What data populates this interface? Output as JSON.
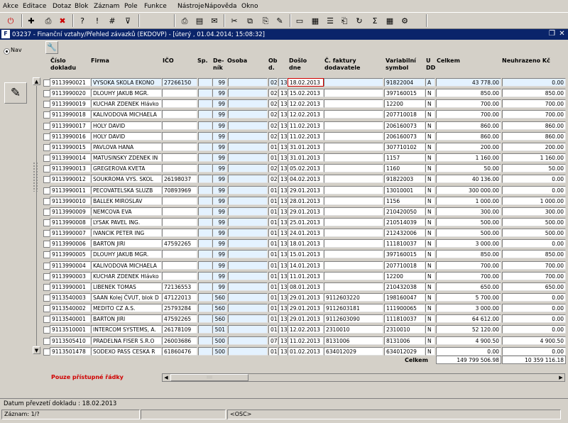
{
  "menu": [
    "Akce",
    "Editace",
    "Dotaz",
    "Blok",
    "Záznam",
    "Pole",
    "Funkce",
    "Nástroje",
    "Nápověda",
    "Okno"
  ],
  "toolbar_icons": [
    {
      "name": "exit-icon",
      "glyph": "⏻",
      "color": "#cc0000"
    },
    {
      "name": "save-icon",
      "glyph": "✚"
    },
    {
      "name": "print-preview-icon",
      "glyph": "⎙"
    },
    {
      "name": "delete-record-icon",
      "glyph": "✖",
      "color": "#cc0000"
    },
    {
      "name": "query-enter-icon",
      "glyph": "?"
    },
    {
      "name": "query-execute-icon",
      "glyph": "!"
    },
    {
      "name": "query-count-icon",
      "glyph": "#"
    },
    {
      "name": "filter-icon",
      "glyph": "⊽"
    },
    {
      "name": "print-icon",
      "glyph": "⎙"
    },
    {
      "name": "report-icon",
      "glyph": "▤"
    },
    {
      "name": "mail-icon",
      "glyph": "✉"
    },
    {
      "name": "cut-icon",
      "glyph": "✂"
    },
    {
      "name": "copy-icon",
      "glyph": "⧉"
    },
    {
      "name": "paste-icon",
      "glyph": "⎘"
    },
    {
      "name": "edit-icon",
      "glyph": "✎"
    },
    {
      "name": "document-icon",
      "glyph": "▭"
    },
    {
      "name": "calculator-icon",
      "glyph": "▦"
    },
    {
      "name": "list-icon",
      "glyph": "☰"
    },
    {
      "name": "attachment-icon",
      "glyph": "⎗"
    },
    {
      "name": "reload-icon",
      "glyph": "↻"
    },
    {
      "name": "sum-icon",
      "glyph": "Σ"
    },
    {
      "name": "grid-icon",
      "glyph": "▦"
    },
    {
      "name": "settings-icon",
      "glyph": "⚙"
    }
  ],
  "window": {
    "title": "03237 - Finanční vztahy/Přehled závazků (EKDOVP) - [úterý , 01.04.2014; 15:08:32]",
    "logo": "F"
  },
  "nav_label": "Nav",
  "columns": {
    "cislo": "Číslo dokladu",
    "firma": "Firma",
    "ico": "IČO",
    "sp": "Sp.",
    "denik": "De-ník",
    "osoba": "Osoba",
    "ob": "Ob d.",
    "doslo": "Došlo dne",
    "cfaktury": "Č. faktury dodavatele",
    "vs": "Variabilní symbol",
    "udd": "U DD",
    "celkem": "Celkem",
    "neuhrazeno": "Neuhrazeno Kč"
  },
  "rows": [
    {
      "cislo": "9113990021",
      "firma": "VYSOKA SKOLA EKONO",
      "ico": "27266150",
      "sp": "",
      "denik": "99",
      "osoba": "",
      "ob": "02",
      "o2": "13",
      "doslo": "18.02.2013",
      "cf": "",
      "vs": "91822004",
      "u": "A",
      "celkem": "43 778.00",
      "neuh": "0.00"
    },
    {
      "cislo": "9113990020",
      "firma": "DLOUHY JAKUB MGR.",
      "ico": "",
      "sp": "",
      "denik": "99",
      "osoba": "",
      "ob": "02",
      "o2": "13",
      "doslo": "15.02.2013",
      "cf": "",
      "vs": "397160015",
      "u": "N",
      "celkem": "850.00",
      "neuh": "850.00"
    },
    {
      "cislo": "9113990019",
      "firma": "KUCHAR ZDENEK Hlávko",
      "ico": "",
      "sp": "",
      "denik": "99",
      "osoba": "",
      "ob": "02",
      "o2": "13",
      "doslo": "12.02.2013",
      "cf": "",
      "vs": "12200",
      "u": "N",
      "celkem": "700.00",
      "neuh": "700.00"
    },
    {
      "cislo": "9113990018",
      "firma": "KALIVODOVA MICHAELA",
      "ico": "",
      "sp": "",
      "denik": "99",
      "osoba": "",
      "ob": "02",
      "o2": "13",
      "doslo": "12.02.2013",
      "cf": "",
      "vs": "207710018",
      "u": "N",
      "celkem": "700.00",
      "neuh": "700.00"
    },
    {
      "cislo": "9113990017",
      "firma": "HOLY DAVID",
      "ico": "",
      "sp": "",
      "denik": "99",
      "osoba": "",
      "ob": "02",
      "o2": "13",
      "doslo": "11.02.2013",
      "cf": "",
      "vs": "206160073",
      "u": "N",
      "celkem": "860.00",
      "neuh": "860.00"
    },
    {
      "cislo": "9113990016",
      "firma": "HOLY DAVID",
      "ico": "",
      "sp": "",
      "denik": "99",
      "osoba": "",
      "ob": "02",
      "o2": "13",
      "doslo": "11.02.2013",
      "cf": "",
      "vs": "206160073",
      "u": "N",
      "celkem": "860.00",
      "neuh": "860.00"
    },
    {
      "cislo": "9113990015",
      "firma": "PAVLOVA HANA",
      "ico": "",
      "sp": "",
      "denik": "99",
      "osoba": "",
      "ob": "01",
      "o2": "13",
      "doslo": "31.01.2013",
      "cf": "",
      "vs": "307710102",
      "u": "N",
      "celkem": "200.00",
      "neuh": "200.00"
    },
    {
      "cislo": "9113990014",
      "firma": "MATUSINSKY ZDENEK IN",
      "ico": "",
      "sp": "",
      "denik": "99",
      "osoba": "",
      "ob": "01",
      "o2": "13",
      "doslo": "31.01.2013",
      "cf": "",
      "vs": "1157",
      "u": "N",
      "celkem": "1 160.00",
      "neuh": "1 160.00"
    },
    {
      "cislo": "9113990013",
      "firma": "GREGEROVA KVETA",
      "ico": "",
      "sp": "",
      "denik": "99",
      "osoba": "",
      "ob": "02",
      "o2": "13",
      "doslo": "05.02.2013",
      "cf": "",
      "vs": "1160",
      "u": "N",
      "celkem": "50.00",
      "neuh": "50.00"
    },
    {
      "cislo": "9113990012",
      "firma": "SOUKROMA VYS. SKOL",
      "ico": "26198037",
      "sp": "",
      "denik": "99",
      "osoba": "",
      "ob": "02",
      "o2": "13",
      "doslo": "04.02.2013",
      "cf": "",
      "vs": "91822003",
      "u": "N",
      "celkem": "40 136.00",
      "neuh": "0.00"
    },
    {
      "cislo": "9113990011",
      "firma": "PECOVATELSKA SLUZB",
      "ico": "70893969",
      "sp": "",
      "denik": "99",
      "osoba": "",
      "ob": "01",
      "o2": "13",
      "doslo": "29.01.2013",
      "cf": "",
      "vs": "13010001",
      "u": "N",
      "celkem": "300 000.00",
      "neuh": "0.00"
    },
    {
      "cislo": "9113990010",
      "firma": "BALLEK MIROSLAV",
      "ico": "",
      "sp": "",
      "denik": "99",
      "osoba": "",
      "ob": "01",
      "o2": "13",
      "doslo": "28.01.2013",
      "cf": "",
      "vs": "1156",
      "u": "N",
      "celkem": "1 000.00",
      "neuh": "1 000.00"
    },
    {
      "cislo": "9113990009",
      "firma": "NEMCOVA EVA",
      "ico": "",
      "sp": "",
      "denik": "99",
      "osoba": "",
      "ob": "01",
      "o2": "13",
      "doslo": "29.01.2013",
      "cf": "",
      "vs": "210420050",
      "u": "N",
      "celkem": "300.00",
      "neuh": "300.00"
    },
    {
      "cislo": "9113990008",
      "firma": "LYSAK PAVEL ING.",
      "ico": "",
      "sp": "",
      "denik": "99",
      "osoba": "",
      "ob": "01",
      "o2": "13",
      "doslo": "25.01.2013",
      "cf": "",
      "vs": "210514039",
      "u": "N",
      "celkem": "500.00",
      "neuh": "500.00"
    },
    {
      "cislo": "9113990007",
      "firma": "IVANCIK PETER ING",
      "ico": "",
      "sp": "",
      "denik": "99",
      "osoba": "",
      "ob": "01",
      "o2": "13",
      "doslo": "24.01.2013",
      "cf": "",
      "vs": "212432006",
      "u": "N",
      "celkem": "500.00",
      "neuh": "500.00"
    },
    {
      "cislo": "9113990006",
      "firma": "BARTON JIRI",
      "ico": "47592265",
      "sp": "",
      "denik": "99",
      "osoba": "",
      "ob": "01",
      "o2": "13",
      "doslo": "18.01.2013",
      "cf": "",
      "vs": "111810037",
      "u": "N",
      "celkem": "3 000.00",
      "neuh": "0.00"
    },
    {
      "cislo": "9113990005",
      "firma": "DLOUHY JAKUB MGR.",
      "ico": "",
      "sp": "",
      "denik": "99",
      "osoba": "",
      "ob": "01",
      "o2": "13",
      "doslo": "15.01.2013",
      "cf": "",
      "vs": "397160015",
      "u": "N",
      "celkem": "850.00",
      "neuh": "850.00"
    },
    {
      "cislo": "9113990004",
      "firma": "KALIVODOVA MICHAELA",
      "ico": "",
      "sp": "",
      "denik": "99",
      "osoba": "",
      "ob": "01",
      "o2": "13",
      "doslo": "14.01.2013",
      "cf": "",
      "vs": "207710018",
      "u": "N",
      "celkem": "700.00",
      "neuh": "700.00"
    },
    {
      "cislo": "9113990003",
      "firma": "KUCHAR ZDENEK Hlávko",
      "ico": "",
      "sp": "",
      "denik": "99",
      "osoba": "",
      "ob": "01",
      "o2": "13",
      "doslo": "11.01.2013",
      "cf": "",
      "vs": "12200",
      "u": "N",
      "celkem": "700.00",
      "neuh": "700.00"
    },
    {
      "cislo": "9113990001",
      "firma": "LIBENEK TOMAS",
      "ico": "72136553",
      "sp": "",
      "denik": "99",
      "osoba": "",
      "ob": "01",
      "o2": "13",
      "doslo": "08.01.2013",
      "cf": "",
      "vs": "210432038",
      "u": "N",
      "celkem": "650.00",
      "neuh": "650.00"
    },
    {
      "cislo": "9113540003",
      "firma": "SAAN Kolej ČVUT, blok D",
      "ico": "47122013",
      "sp": "",
      "denik": "560",
      "osoba": "",
      "ob": "01",
      "o2": "13",
      "doslo": "29.01.2013",
      "cf": "9112603220",
      "vs": "198160047",
      "u": "N",
      "celkem": "5 700.00",
      "neuh": "0.00"
    },
    {
      "cislo": "9113540002",
      "firma": "MEDITO CZ A.S.",
      "ico": "25793284",
      "sp": "",
      "denik": "560",
      "osoba": "",
      "ob": "01",
      "o2": "13",
      "doslo": "29.01.2013",
      "cf": "9112603181",
      "vs": "111900065",
      "u": "N",
      "celkem": "3 000.00",
      "neuh": "0.00"
    },
    {
      "cislo": "9113540001",
      "firma": "BARTON JIRI",
      "ico": "47592265",
      "sp": "",
      "denik": "560",
      "osoba": "",
      "ob": "01",
      "o2": "13",
      "doslo": "29.01.2013",
      "cf": "9112603090",
      "vs": "111810037",
      "u": "N",
      "celkem": "64 612.00",
      "neuh": "0.00"
    },
    {
      "cislo": "9113510001",
      "firma": "INTERCOM SYSTEMS, A.",
      "ico": "26178109",
      "sp": "",
      "denik": "501",
      "osoba": "",
      "ob": "01",
      "o2": "13",
      "doslo": "12.02.2013",
      "cf": "2310010",
      "vs": "2310010",
      "u": "N",
      "celkem": "52 120.00",
      "neuh": "0.00"
    },
    {
      "cislo": "9113505410",
      "firma": "PRADELNA FISER S.R.O",
      "ico": "26003686",
      "sp": "",
      "denik": "500",
      "osoba": "",
      "ob": "07",
      "o2": "13",
      "doslo": "11.02.2013",
      "cf": "8131006",
      "vs": "8131006",
      "u": "N",
      "celkem": "4 900.50",
      "neuh": "4 900.50"
    },
    {
      "cislo": "9113501478",
      "firma": "SODEXO PASS CESKA R",
      "ico": "61860476",
      "sp": "",
      "denik": "500",
      "osoba": "",
      "ob": "01",
      "o2": "13",
      "doslo": "01.02.2013",
      "cf": "634012029",
      "vs": "634012029",
      "u": "N",
      "celkem": "0.00",
      "neuh": "0.00"
    }
  ],
  "totals": {
    "label": "Celkem",
    "celkem": "149 799 506.98",
    "neuhrazeno": "10 359 116.18"
  },
  "note": "Pouze přístupné řádky",
  "status": {
    "line1": "Datum převzetí dokladu : 18.02.2013",
    "record": "Záznam: 1/?",
    "osc": "<OSC>"
  }
}
